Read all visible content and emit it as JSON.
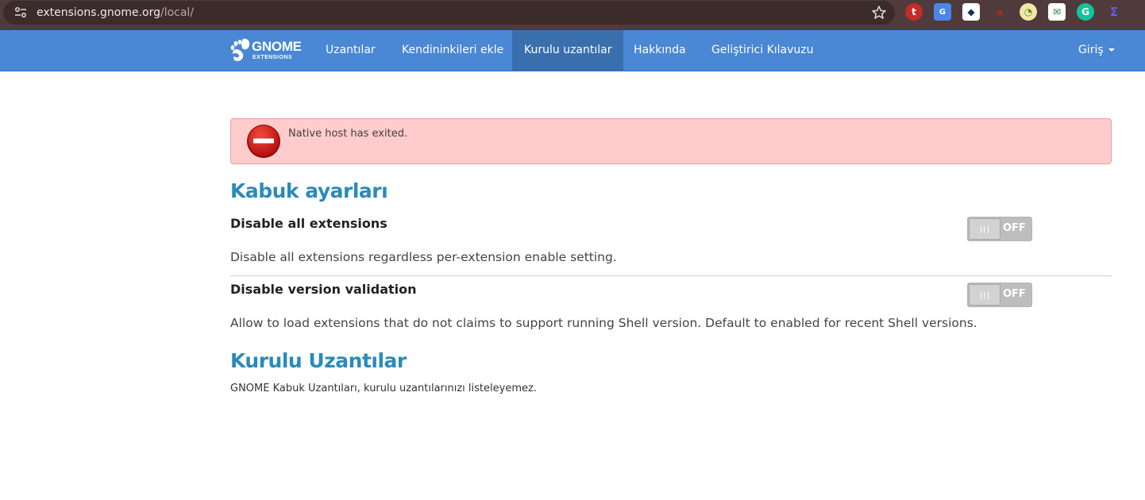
{
  "browser": {
    "url_host": "extensions.gnome.org",
    "url_path": "/local/"
  },
  "navbar": {
    "logo_text": "GNOME",
    "logo_sub": "EXTENSIONS",
    "items": [
      {
        "label": "Uzantılar"
      },
      {
        "label": "Kendininkileri ekle"
      },
      {
        "label": "Kurulu uzantılar"
      },
      {
        "label": "Hakkında"
      },
      {
        "label": "Geliştirici Kılavuzu"
      }
    ],
    "login": "Giriş"
  },
  "alert": {
    "message": "Native host has exited."
  },
  "shell_settings": {
    "heading": "Kabuk ayarları",
    "settings": [
      {
        "title": "Disable all extensions",
        "description": "Disable all extensions regardless per-extension enable setting.",
        "state": "OFF"
      },
      {
        "title": "Disable version validation",
        "description": "Allow to load extensions that do not claims to support running Shell version. Default to enabled for recent Shell versions.",
        "state": "OFF"
      }
    ]
  },
  "installed": {
    "heading": "Kurulu Uzantılar",
    "message": "GNOME Kabuk Uzantıları, kurulu uzantılarınızı listeleyemez."
  },
  "colors": {
    "navbar": "#4a87d4",
    "navbar_active": "#3a6fae",
    "heading": "#2b8bb8",
    "alert_bg": "#fecccc"
  }
}
